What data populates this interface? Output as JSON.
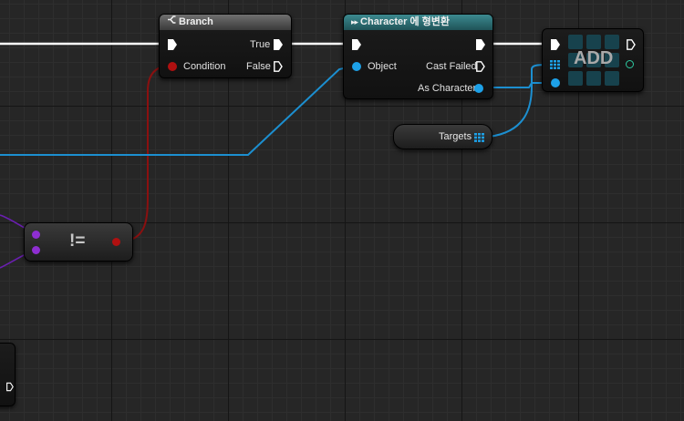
{
  "colors": {
    "exec": "#ffffff",
    "bool": "#b01010",
    "object": "#1da1e8",
    "compare": "#8e2ed1",
    "add_out": "#2ec8a0"
  },
  "branch_node": {
    "title": "Branch",
    "icon": "branch-icon",
    "condition_label": "Condition",
    "true_label": "True",
    "false_label": "False"
  },
  "cast_node": {
    "title": "Character 에 형변환",
    "object_label": "Object",
    "cast_failed_label": "Cast Failed",
    "as_character_label": "As Character"
  },
  "add_node": {
    "label": "ADD",
    "icon": "array-grid-icon"
  },
  "targets_node": {
    "label": "Targets",
    "icon": "array-grid-icon"
  },
  "compare_node": {
    "label": "!="
  }
}
